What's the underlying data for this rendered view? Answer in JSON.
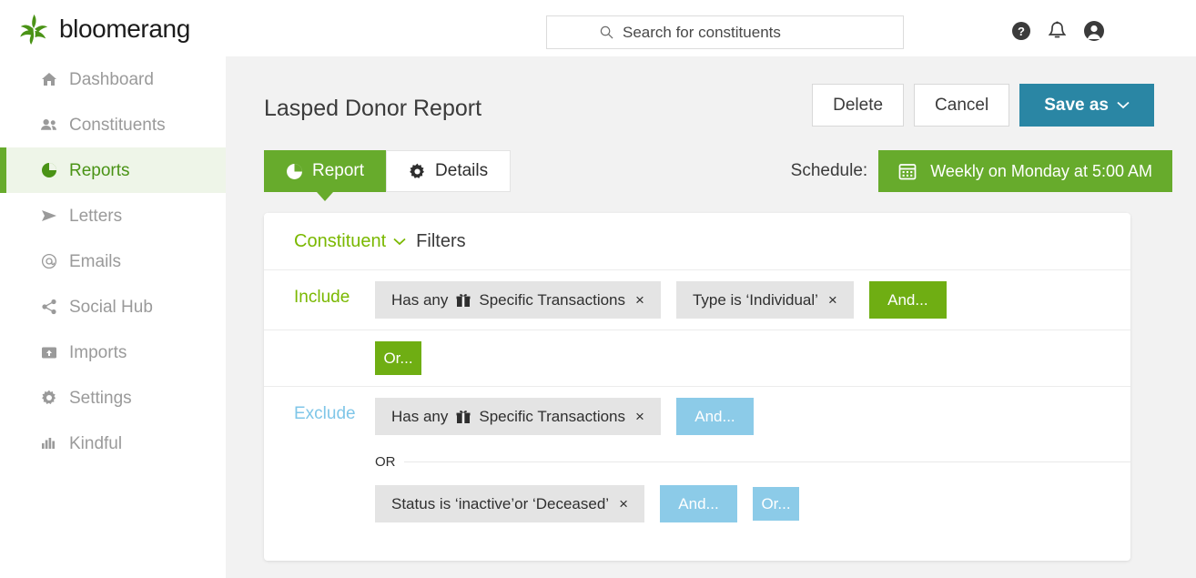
{
  "brand": {
    "name": "bloomerang",
    "logo_color": "#4a9316",
    "accent_green": "#7ab800",
    "accent_blue": "#8ccbe8",
    "primary_button_color": "#2a86a4"
  },
  "search": {
    "placeholder": "Search for constituents",
    "value": "",
    "icon": "search-icon"
  },
  "topbar_icons": [
    {
      "name": "help-icon",
      "glyph": "?"
    },
    {
      "name": "notifications-bell-icon",
      "glyph": "bell"
    },
    {
      "name": "user-avatar-icon",
      "glyph": "person"
    }
  ],
  "sidebar": {
    "items": [
      {
        "label": "Dashboard",
        "icon": "home-icon",
        "active": false
      },
      {
        "label": "Constituents",
        "icon": "people-icon",
        "active": false
      },
      {
        "label": "Reports",
        "icon": "pie-chart-icon",
        "active": true
      },
      {
        "label": "Letters",
        "icon": "paper-plane-icon",
        "active": false
      },
      {
        "label": "Emails",
        "icon": "at-sign-icon",
        "active": false
      },
      {
        "label": "Social Hub",
        "icon": "share-icon",
        "active": false
      },
      {
        "label": "Imports",
        "icon": "upload-box-icon",
        "active": false
      },
      {
        "label": "Settings",
        "icon": "gear-icon",
        "active": false
      },
      {
        "label": "Kindful",
        "icon": "bar-chart-icon",
        "active": false
      }
    ]
  },
  "page": {
    "title": "Lasped Donor Report",
    "actions": {
      "delete_label": "Delete",
      "cancel_label": "Cancel",
      "save_as_label": "Save as"
    }
  },
  "tabs": [
    {
      "label": "Report",
      "icon": "pie-chart-icon",
      "active": true
    },
    {
      "label": "Details",
      "icon": "gear-icon",
      "active": false
    }
  ],
  "schedule": {
    "label": "Schedule:",
    "value": "Weekly on Monday at 5:00 AM",
    "icon": "calendar-icon"
  },
  "filter_panel": {
    "entity": "Constituent",
    "entity_chevron": "chevron-down-icon",
    "filters_word": "Filters",
    "include": {
      "label": "Include",
      "chips": [
        {
          "text": "Has any",
          "icon": "gift-icon",
          "detail": "Specific Transactions",
          "remove": "×"
        },
        {
          "text": "Type is ‘Individual’",
          "icon": "",
          "detail": "",
          "remove": "×"
        }
      ],
      "and_label": "And...",
      "or_label": "Or..."
    },
    "exclude": {
      "label": "Exclude",
      "chips": [
        {
          "text": "Has any",
          "icon": "gift-icon",
          "detail": "Specific Transactions",
          "remove": "×"
        }
      ],
      "and_label": "And...",
      "or_separator": "OR",
      "second_chip": {
        "text": "Status is ‘inactive’or ‘Deceased’",
        "remove": "×"
      },
      "second_and_label": "And...",
      "or_label": "Or..."
    }
  }
}
